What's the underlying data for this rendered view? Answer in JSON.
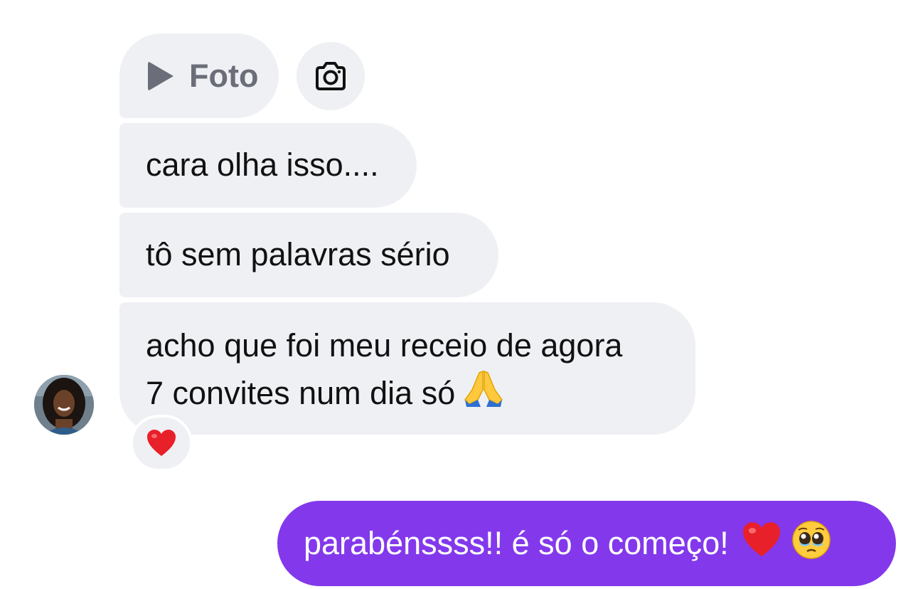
{
  "media_message": {
    "label": "Foto",
    "play_icon": "play-icon",
    "camera_icon": "camera-icon"
  },
  "messages_received": [
    {
      "text": "cara olha isso...."
    },
    {
      "text": "tô sem palavras sério"
    },
    {
      "lines": [
        "acho que foi meu receio de agora",
        "7 convites num dia só"
      ],
      "emoji": "folded-hands-emoji"
    }
  ],
  "reaction": {
    "emoji": "red-heart-emoji"
  },
  "message_sent": {
    "text": "parabénssss!! é só o começo!",
    "emojis": [
      "red-heart-emoji",
      "pleading-face-emoji"
    ]
  },
  "colors": {
    "incoming_bubble": "#eff0f4",
    "outgoing_bubble": "#8338ec",
    "muted_text": "#6b6e78"
  }
}
